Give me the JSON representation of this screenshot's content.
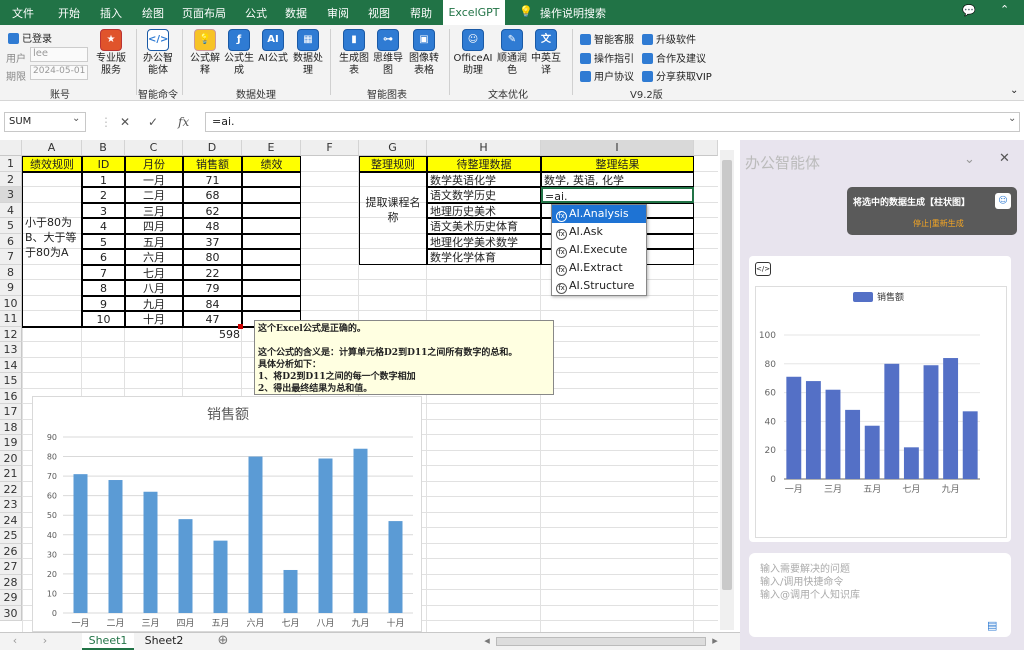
{
  "menubar": {
    "items": [
      "文件",
      "开始",
      "插入",
      "绘图",
      "页面布局",
      "公式",
      "数据",
      "审阅",
      "视图",
      "帮助"
    ],
    "active": "ExcelGPT",
    "search": "操作说明搜索"
  },
  "ribbon": {
    "account": {
      "login": "已登录",
      "user_label": "用户",
      "user_value": "lee",
      "expire_label": "期限",
      "expire_value": "2024-05-01",
      "pro": "专业版服务",
      "group": "账号"
    },
    "smart": {
      "btn": "办公智能体",
      "group": "智能命令"
    },
    "data": {
      "btns": [
        "公式解释",
        "公式生成",
        "AI公式",
        "数据处理"
      ],
      "group": "数据处理"
    },
    "charts": {
      "btns": [
        "生成图表",
        "思维导图",
        "图像转表格"
      ],
      "group": "智能图表"
    },
    "text": {
      "btns": [
        "OfficeAI助理",
        "顺通润色",
        "中英互译"
      ],
      "group": "文本优化"
    },
    "right": {
      "items": [
        "智能客服",
        "升级软件",
        "操作指引",
        "合作及建议",
        "用户协议",
        "分享获取VIP"
      ],
      "group": "V9.2版"
    }
  },
  "formula_bar": {
    "name": "SUM",
    "content": "=ai."
  },
  "columns": [
    "A",
    "B",
    "C",
    "D",
    "E",
    "F",
    "G",
    "H",
    "I"
  ],
  "rows": [
    "1",
    "2",
    "3",
    "4",
    "5",
    "6",
    "7",
    "8",
    "9",
    "10",
    "11",
    "12",
    "13",
    "14",
    "15",
    "16",
    "17",
    "18",
    "19",
    "20",
    "21",
    "22",
    "23",
    "24",
    "25",
    "26",
    "27",
    "28",
    "29",
    "30"
  ],
  "table1": {
    "headers": [
      "绩效规则",
      "ID",
      "月份",
      "销售额",
      "绩效"
    ],
    "rule": "小于80为B、大于等于80为A",
    "ids": [
      "1",
      "2",
      "3",
      "4",
      "5",
      "6",
      "7",
      "8",
      "9",
      "10"
    ],
    "months": [
      "一月",
      "二月",
      "三月",
      "四月",
      "五月",
      "六月",
      "七月",
      "八月",
      "九月",
      "十月"
    ],
    "sales": [
      "71",
      "68",
      "62",
      "48",
      "37",
      "80",
      "22",
      "79",
      "84",
      "47"
    ],
    "total": "598"
  },
  "table2": {
    "headers": [
      "整理规则",
      "待整理数据",
      "整理结果"
    ],
    "rule": "提取课程名称",
    "data": [
      "数学英语化学",
      "语文数学历史",
      "地理历史美术",
      "语文美术历史体育",
      "地理化学美术数学",
      "数学化学体育"
    ],
    "result1": "数学, 英语, 化学",
    "editing": "=ai."
  },
  "autocomplete": [
    "AI.Analysis",
    "AI.Ask",
    "AI.Execute",
    "AI.Extract",
    "AI.Structure"
  ],
  "comment": "这个Excel公式是正确的。\n\n这个公式的含义是：计算单元格D2到D11之间所有数字的总和。\n具体分析如下：\n1、将D2到D11之间的每一个数字相加\n2、得出最终结果为总和值。",
  "sheet_tabs": [
    "Sheet1",
    "Sheet2"
  ],
  "panel": {
    "title": "办公智能体",
    "bubble": "将选中的数据生成【柱状图】",
    "stop": "停止|重新生成",
    "input_placeholder": "输入需要解决的问题\n输入/调用快捷命令\n输入@调用个人知识库"
  },
  "chart_data": [
    {
      "type": "bar",
      "title": "销售额",
      "categories": [
        "一月",
        "二月",
        "三月",
        "四月",
        "五月",
        "六月",
        "七月",
        "八月",
        "九月",
        "十月"
      ],
      "values": [
        71,
        68,
        62,
        48,
        37,
        80,
        22,
        79,
        84,
        47
      ],
      "ylim": [
        0,
        90
      ],
      "yticks": [
        0,
        10,
        20,
        30,
        40,
        50,
        60,
        70,
        80,
        90
      ],
      "color": "#5b9bd5"
    },
    {
      "type": "bar",
      "legend": "销售额",
      "categories": [
        "一月",
        "二月",
        "三月",
        "四月",
        "五月",
        "六月",
        "七月",
        "八月",
        "九月",
        "十月"
      ],
      "xticks": [
        "一月",
        "三月",
        "五月",
        "七月",
        "九月"
      ],
      "values": [
        71,
        68,
        62,
        48,
        37,
        80,
        22,
        79,
        84,
        47
      ],
      "ylim": [
        0,
        100
      ],
      "yticks": [
        0,
        20,
        40,
        60,
        80,
        100
      ],
      "color": "#5470c6"
    }
  ]
}
